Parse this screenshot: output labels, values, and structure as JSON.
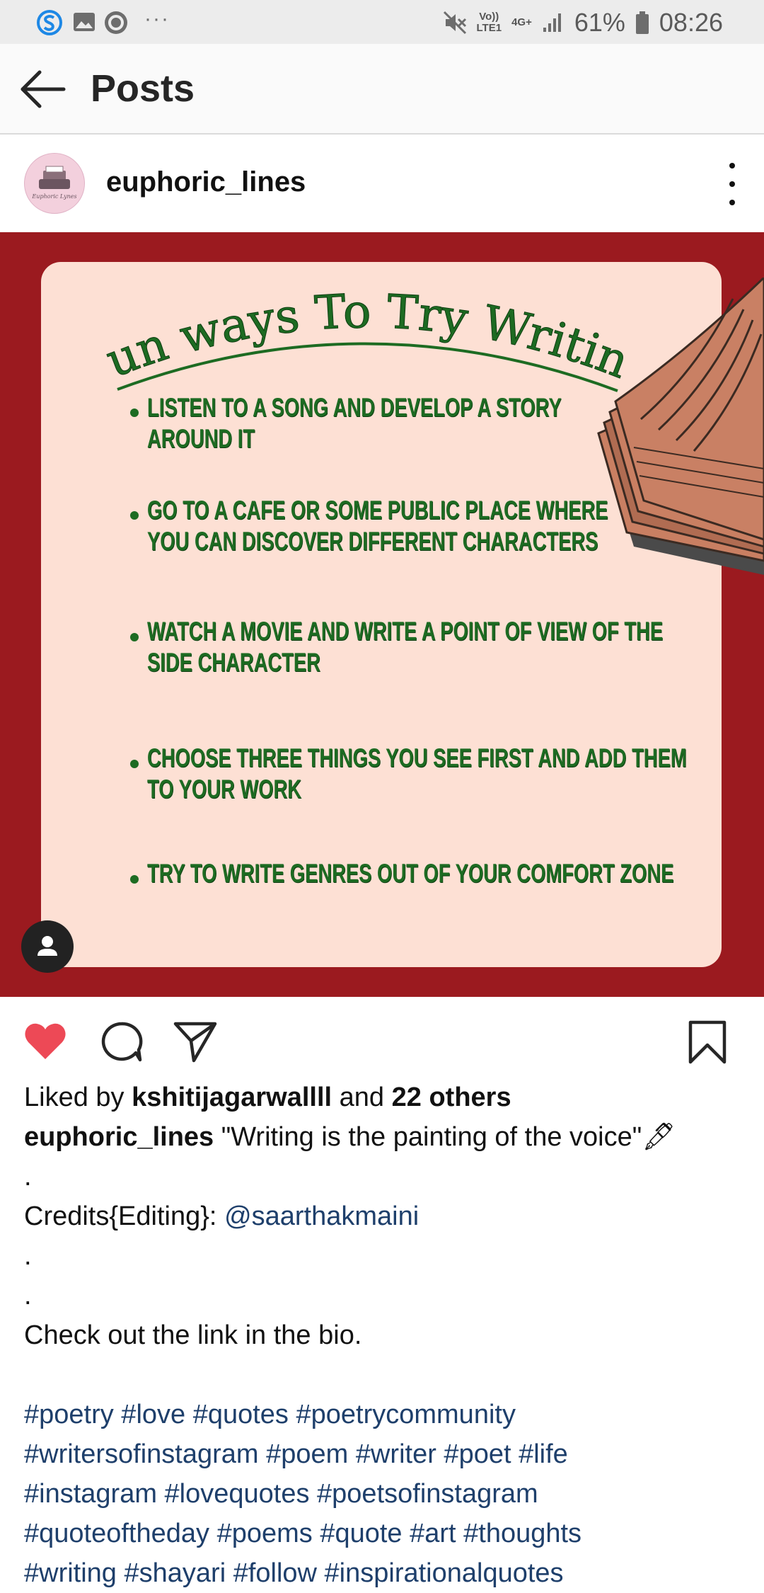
{
  "status_bar": {
    "battery_text": "61%",
    "time": "08:26",
    "net_top": "Vo))",
    "net_bottom": "LTE1",
    "net_type": "4G+",
    "more_label": "···",
    "icons": [
      "s-app-icon",
      "gallery-icon",
      "circle-app-icon",
      "mute-icon",
      "signal-icon",
      "battery-icon"
    ]
  },
  "header": {
    "title": "Posts"
  },
  "post": {
    "username": "euphoric_lines",
    "avatar_text": "Euphoric Lynes",
    "image": {
      "title": "Fun ways To Try Writing",
      "tips": [
        [
          "LISTEN TO A SONG AND DEVELOP A STORY",
          "AROUND IT"
        ],
        [
          "GO TO A CAFE OR SOME PUBLIC PLACE  WHERE",
          "YOU CAN DISCOVER DIFFERENT CHARACTERS"
        ],
        [
          "WATCH A MOVIE AND WRITE A POINT OF VIEW OF THE",
          "SIDE CHARACTER"
        ],
        [
          "CHOOSE THREE THINGS YOU SEE FIRST AND ADD THEM",
          "TO YOUR WORK"
        ],
        [
          "TRY TO WRITE GENRES OUT OF YOUR COMFORT ZONE"
        ]
      ],
      "colors": {
        "background": "#9b1a1f",
        "card": "#fde0d4",
        "text": "#1d6b22"
      }
    },
    "likes": {
      "prefix": "Liked by ",
      "user": "kshitijagarwallll",
      "middle": " and ",
      "others": "22 others"
    },
    "caption": {
      "username": "euphoric_lines",
      "text": " \"Writing is the painting of the voice\"",
      "emoji": "🖋",
      "dot": ".",
      "credits_label": "Credits{Editing}: ",
      "credits_handle": "@saarthakmaini",
      "bio_line": "Check out the link in the bio.",
      "hashtag_lines": [
        "#poetry #love #quotes #poetrycommunity",
        "#writersofinstagram #poem #writer #poet #life",
        "#instagram #lovequotes #poetsofinstagram",
        "#quoteoftheday #poems #quote #art #thoughts",
        "#writing #shayari #follow #inspirationalquotes"
      ]
    },
    "colors": {
      "like_red": "#ed4956",
      "link_blue": "#1e3f6b"
    }
  }
}
